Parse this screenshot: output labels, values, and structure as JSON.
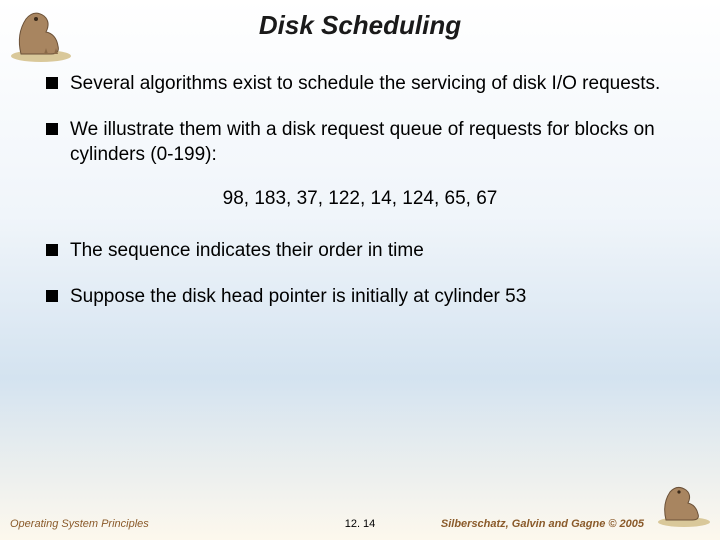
{
  "slide": {
    "title": "Disk Scheduling",
    "bullets": [
      "Several algorithms exist to schedule the servicing of disk I/O requests.",
      "We illustrate them with a disk request queue of requests for blocks on cylinders (0-199):"
    ],
    "queue": "98, 183, 37, 122, 14, 124, 65, 67",
    "bullets_after": [
      "The sequence indicates their order in time",
      "Suppose the disk head pointer is initially at cylinder 53"
    ]
  },
  "footer": {
    "left": "Operating System Principles",
    "center": "12. 14",
    "right": "Silberschatz, Galvin and Gagne © 2005"
  }
}
